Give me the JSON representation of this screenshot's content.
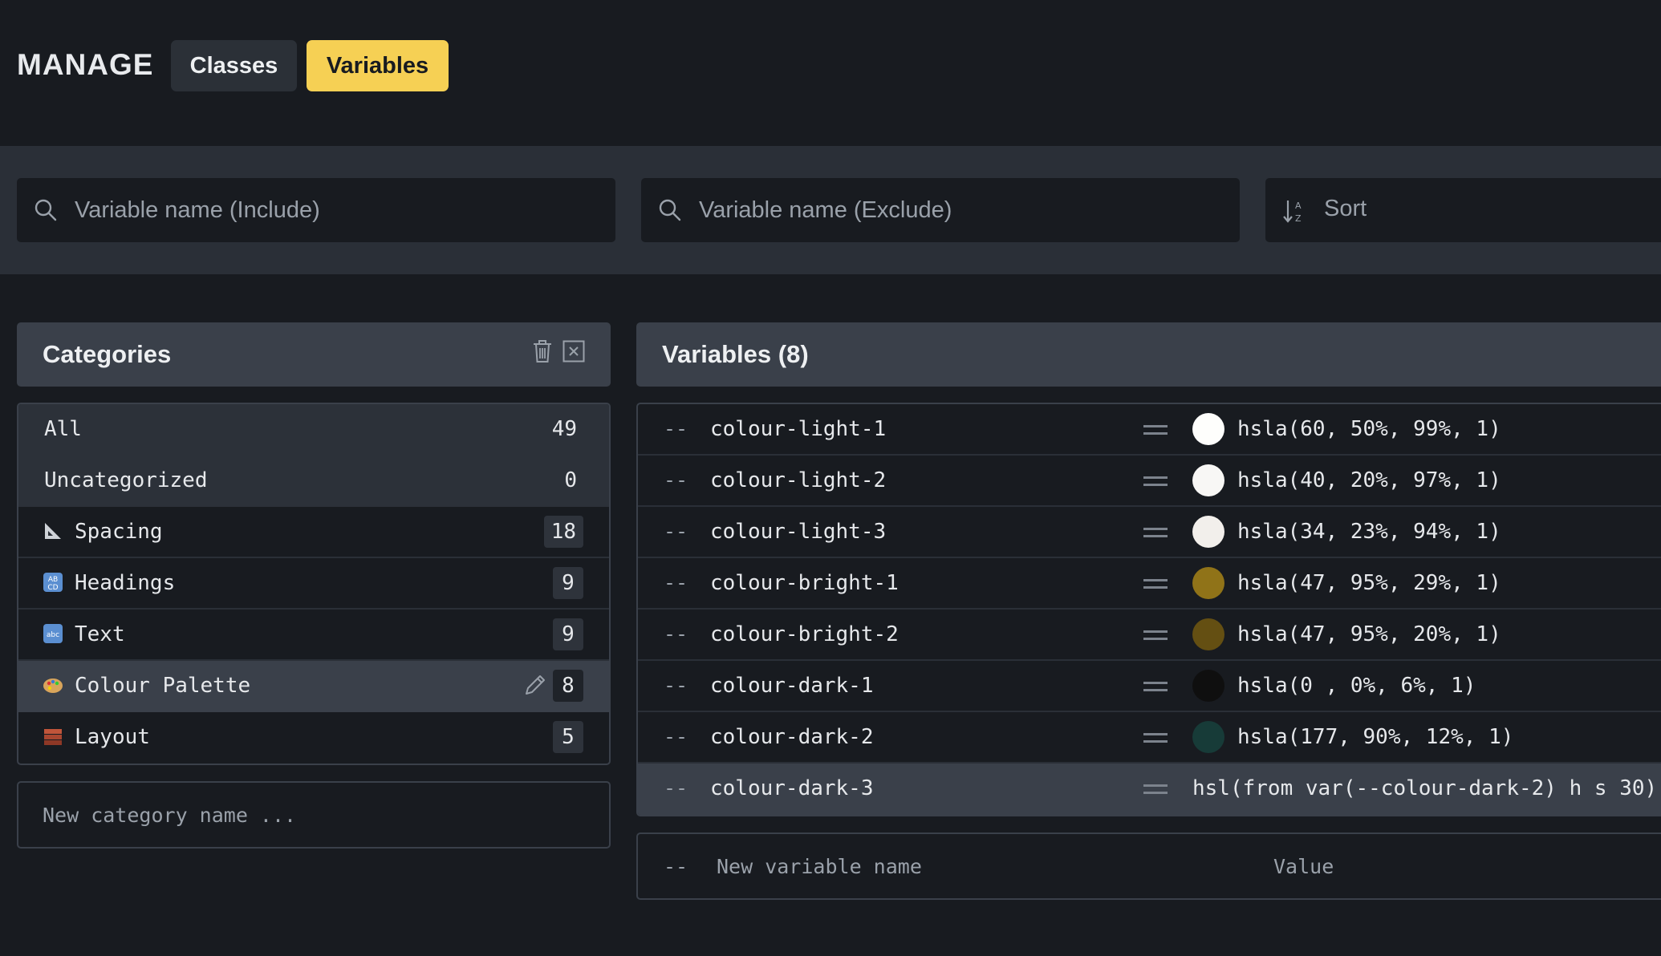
{
  "header": {
    "title": "MANAGE",
    "tabs": [
      {
        "label": "Classes",
        "active": false
      },
      {
        "label": "Variables",
        "active": true
      }
    ]
  },
  "filters": {
    "include_placeholder": "Variable name (Include)",
    "exclude_placeholder": "Variable name (Exclude)",
    "sort_label": "Sort"
  },
  "categories": {
    "title": "Categories",
    "icons": [
      "trash-icon",
      "close-box-icon"
    ],
    "items": [
      {
        "label": "All",
        "count": "49",
        "emoji": null
      },
      {
        "label": "Uncategorized",
        "count": "0",
        "emoji": null
      },
      {
        "label": "Spacing",
        "count": "18",
        "emoji": "triangle-ruler-icon"
      },
      {
        "label": "Headings",
        "count": "9",
        "emoji": "abcd-icon"
      },
      {
        "label": "Text",
        "count": "9",
        "emoji": "abc-icon"
      },
      {
        "label": "Colour Palette",
        "count": "8",
        "emoji": "palette-icon",
        "selected": true
      },
      {
        "label": "Layout",
        "count": "5",
        "emoji": "bricks-icon"
      }
    ],
    "new_placeholder": "New category name ..."
  },
  "variables": {
    "title": "Variables (8)",
    "prefix": "--",
    "items": [
      {
        "name": "colour-light-1",
        "value": "hsla(60, 50%, 99%, 1)",
        "swatch": "#fefefc"
      },
      {
        "name": "colour-light-2",
        "value": "hsla(40, 20%, 97%, 1)",
        "swatch": "#f8f7f5"
      },
      {
        "name": "colour-light-3",
        "value": "hsla(34, 23%, 94%, 1)",
        "swatch": "#f2efeb"
      },
      {
        "name": "colour-bright-1",
        "value": "hsla(47, 95%, 29%, 1)",
        "swatch": "#907318"
      },
      {
        "name": "colour-bright-2",
        "value": "hsla(47, 95%, 20%, 1)",
        "swatch": "#644f12"
      },
      {
        "name": "colour-dark-1",
        "value": "hsla(0 , 0%, 6%, 1)",
        "swatch": "#0f0f0f"
      },
      {
        "name": "colour-dark-2",
        "value": "hsla(177, 90%, 12%, 1)",
        "swatch": "#173b38"
      },
      {
        "name": "colour-dark-3",
        "value": "hsl(from var(--colour-dark-2) h s 30)",
        "swatch": null,
        "selected": true
      }
    ],
    "new_name_placeholder": "New variable name",
    "new_value_placeholder": "Value"
  },
  "colors": {
    "accent": "#f6d054",
    "background": "#181b20",
    "panel": "#3a404a"
  }
}
